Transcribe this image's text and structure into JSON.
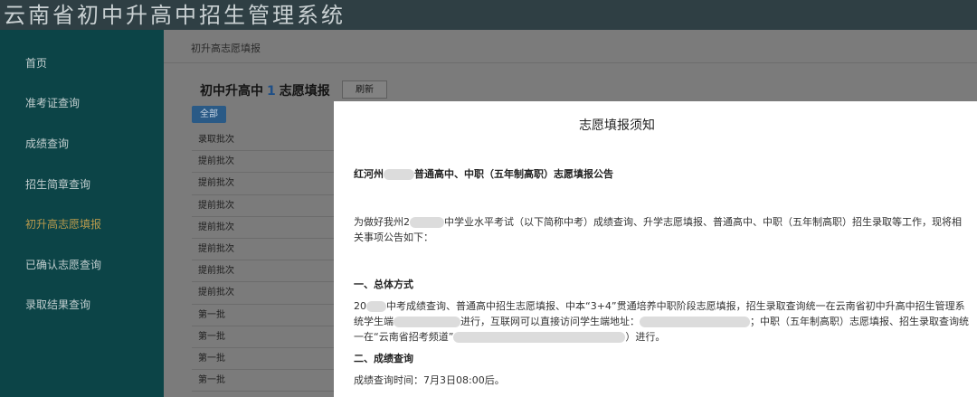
{
  "app": {
    "title": "云南省初中升高中招生管理系统"
  },
  "sidebar": {
    "items": [
      {
        "label": "首页"
      },
      {
        "label": "准考证查询"
      },
      {
        "label": "成绩查询"
      },
      {
        "label": "招生简章查询"
      },
      {
        "label": "初升高志愿填报",
        "active": true
      },
      {
        "label": "已确认志愿查询"
      },
      {
        "label": "录取结果查询"
      }
    ]
  },
  "main": {
    "breadcrumb": "初升高志愿填报",
    "title_prefix": "初中升高中",
    "title_number": "1",
    "title_suffix": "志愿填报",
    "refresh_label": "刷新",
    "all_label": "全部",
    "batches": [
      "录取批次",
      "提前批次",
      "提前批次",
      "提前批次",
      "提前批次",
      "提前批次",
      "提前批次",
      "提前批次",
      "第一批",
      "第一批",
      "第一批",
      "第一批"
    ]
  },
  "modal": {
    "title": "志愿填报须知",
    "notice_title_a": "红河州",
    "notice_title_b": "普通高中、中职（五年制高职）志愿填报公告",
    "para1_a": "为做好我州2",
    "para1_b": "中学业水平考试（以下简称中考）成绩查询、升学志愿填报、普通高中、中职（五年制高职）招生录取等工作，现将相关事项公告如下：",
    "section1": "一、总体方式",
    "para2_a": "20",
    "para2_b": "中考成绩查询、普通高中招生志愿填报、中本“3+4”贯通培养中职阶段志愿填报，招生录取查询统一在云南省初中升高中招生管理系统学生端",
    "para2_c": "进行，互联网可以直接访问学生端地址：",
    "para2_d": "；中职（五年制高职）志愿填报、招生录取查询统一在“云南省招考频道”",
    "para2_e": "）进行。",
    "section2": "二、成绩查询",
    "para3": "成绩查询时间：7月3日08:00后。"
  }
}
